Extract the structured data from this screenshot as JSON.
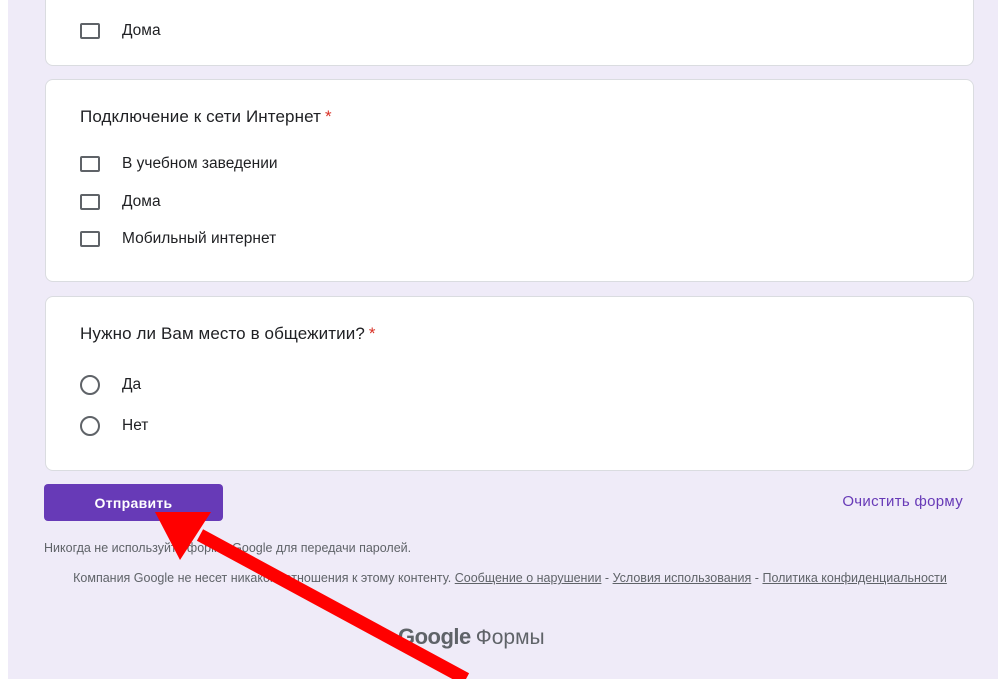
{
  "top_card": {
    "options": [
      {
        "label": "Дома"
      }
    ]
  },
  "internet_question": {
    "title": "Подключение к сети Интернет",
    "required_marker": "*",
    "options": [
      {
        "label": "В учебном заведении"
      },
      {
        "label": "Дома"
      },
      {
        "label": "Мобильный интернет"
      }
    ]
  },
  "dorm_question": {
    "title": "Нужно ли Вам место в общежитии?",
    "required_marker": "*",
    "options": [
      {
        "label": "Да"
      },
      {
        "label": "Нет"
      }
    ]
  },
  "actions": {
    "submit_label": "Отправить",
    "clear_label": "Очистить форму"
  },
  "footer": {
    "password_warning": "Никогда не используйте формы Google для передачи паролей.",
    "disclaimer_text": "Компания Google не несет никакого отношения к этому контенту.",
    "report_abuse": "Сообщение о нарушении",
    "separator": "-",
    "terms": "Условия использования",
    "privacy": "Политика конфиденциальности",
    "brand_logo": "Google",
    "brand_product": "Формы"
  },
  "colors": {
    "accent": "#673ab7",
    "background": "#efebf8",
    "required": "#d93025",
    "annotation_arrow": "#ff0000"
  },
  "icons": {
    "checkbox": "checkbox-icon",
    "radio": "radio-icon",
    "annotation": "red-arrow-icon"
  }
}
